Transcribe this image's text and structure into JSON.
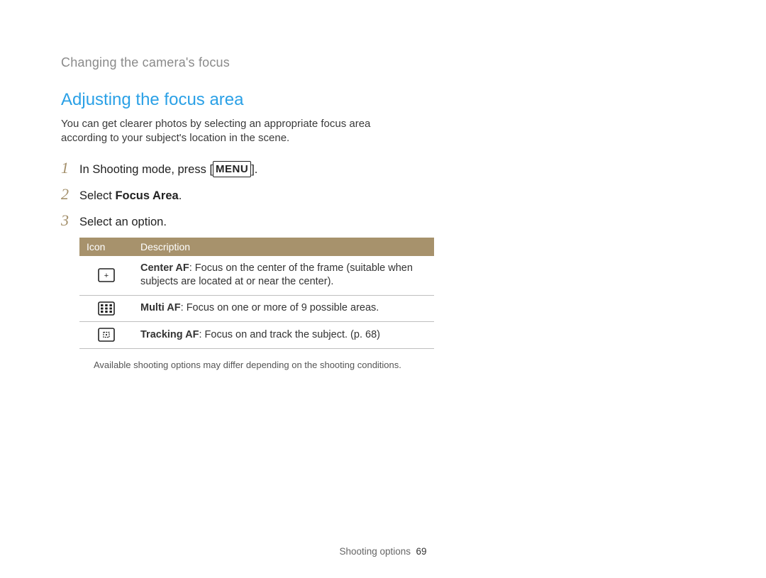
{
  "breadcrumb": "Changing the camera's focus",
  "section_title": "Adjusting the focus area",
  "intro": "You can get clearer photos by selecting an appropriate focus area according to your subject's location in the scene.",
  "steps": {
    "s1": {
      "num": "1",
      "pre": "In Shooting mode, press [",
      "menu": "MENU",
      "post": "]."
    },
    "s2": {
      "num": "2",
      "pre": "Select ",
      "bold": "Focus Area",
      "post": "."
    },
    "s3": {
      "num": "3",
      "text": "Select an option."
    }
  },
  "table": {
    "head_icon": "Icon",
    "head_desc": "Description",
    "rows": [
      {
        "icon": "center-af-icon",
        "name": "Center AF",
        "desc": ": Focus on the center of the frame (suitable when subjects are located at or near the center)."
      },
      {
        "icon": "multi-af-icon",
        "name": "Multi AF",
        "desc": ": Focus on one or more of 9 possible areas."
      },
      {
        "icon": "tracking-af-icon",
        "name": "Tracking AF",
        "desc": ": Focus on and track the subject. (p. 68)"
      }
    ]
  },
  "note": "Available shooting options may differ depending on the shooting conditions.",
  "footer": {
    "section": "Shooting options",
    "page": "69"
  }
}
